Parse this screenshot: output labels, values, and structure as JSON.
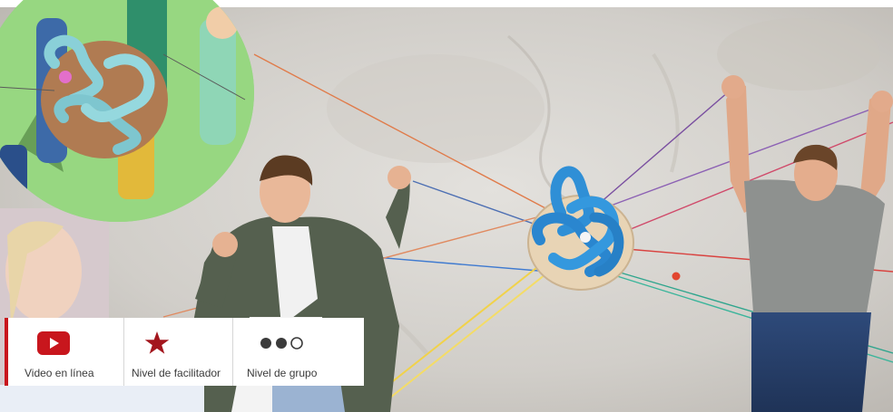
{
  "info_strip": {
    "video": {
      "icon": "youtube-play-icon",
      "label": "Video en línea",
      "accent": "#c8161d"
    },
    "facilitator": {
      "icon": "star-icon",
      "label": "Nivel de facilitador",
      "accent": "#a3161d"
    },
    "group": {
      "icon": "dots-level-icon",
      "label": "Nivel de grupo",
      "level_filled": 2,
      "level_total": 3,
      "accent": "#3b3b3b"
    }
  },
  "colors": {
    "brand_red": "#c8161d",
    "wall": "#d6d3cf",
    "toy_blue": "#2f8fd6",
    "text": "#3b3b3b"
  }
}
